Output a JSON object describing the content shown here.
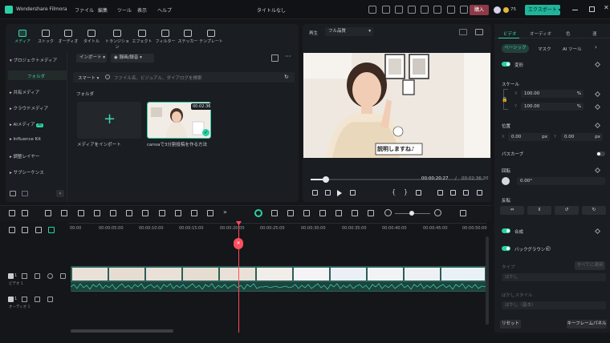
{
  "app": {
    "name": "Wondershare Filmora",
    "doc_title": "タイトルなし"
  },
  "menu": [
    "ファイル",
    "編集",
    "ツール",
    "表示",
    "ヘルプ"
  ],
  "titlebar": {
    "buy": "購入",
    "credits": "75",
    "export": "エクスポート"
  },
  "library": {
    "tabs": [
      "メディア",
      "ストック",
      "オーディオ",
      "タイトル",
      "トランジション",
      "エフェクト",
      "フィルター",
      "ステッカー",
      "テンプレート"
    ],
    "sidebar": {
      "project_media": "プロジェクトメディア",
      "folder": "フォルダ",
      "shared_media": "共有メディア",
      "cloud_media": "クラウドメディア",
      "ai_media": "AIメディア",
      "ai_badge": "AI",
      "influence_kit": "Influence Kit",
      "adjust_layer": "調整レイヤー",
      "subsequence": "サブシーケンス"
    },
    "import_label": "インポート",
    "record_label": "録画/録音",
    "smart_label": "スマート",
    "search_placeholder": "ファイル名、ビジュアル、ダイアログを検索",
    "folder_title": "フォルダ",
    "import_tile_label": "メディアをインポート",
    "video_tile_label": "canvaで3分割投稿を作る方法",
    "video_tile_duration": "00:02:36"
  },
  "player": {
    "label": "再生",
    "quality": "フル品質",
    "current_time": "00:00:20:27",
    "separator": "/",
    "total_time": "00:02:36:20",
    "progress": 0.09,
    "caption": "説明しますね♪"
  },
  "properties": {
    "tabs": [
      "ビデオ",
      "オーディオ",
      "色",
      "速"
    ],
    "subtabs": [
      "ベーシック",
      "マスク",
      "AI ツール"
    ],
    "transform": "変形",
    "scale": "スケール",
    "scale_x_label": "X",
    "scale_x": "100.00",
    "scale_y_label": "Y",
    "scale_y": "100.00",
    "pct": "%",
    "position": "位置",
    "pos_x_label": "X",
    "pos_x": "0.00",
    "pos_y_label": "Y",
    "pos_y": "0.00",
    "px": "px",
    "perspective": "パスカーブ",
    "rotation": "回転",
    "rotation_value": "0.00°",
    "flip": "反転",
    "composite": "合成",
    "background": "バックグラウンド",
    "type": "タイプ",
    "apply_all": "すべてに適用",
    "blur1": "ぼかし",
    "blur_style": "ぼかしスタイル",
    "blur2": "ぼかし（基本）",
    "reset": "リセット",
    "keyframe_panel": "キーフレームパネル"
  },
  "timeline": {
    "ticks": [
      "00:00",
      "00:00:05:00",
      "00:00:10:00",
      "00:00:15:00",
      "00:00:20:00",
      "00:00:25:00",
      "00:00:30:00",
      "00:00:35:00",
      "00:00:40:00",
      "00:00:45:00",
      "00:00:50:00"
    ],
    "video_track": "ビデオ 1",
    "audio_track": "オーディオ 1",
    "track_num": "1",
    "playhead_marker": "✕"
  },
  "colors": {
    "accent": "#2ad1a6",
    "playhead": "#ff4d5e",
    "buy": "#8d3a48"
  }
}
